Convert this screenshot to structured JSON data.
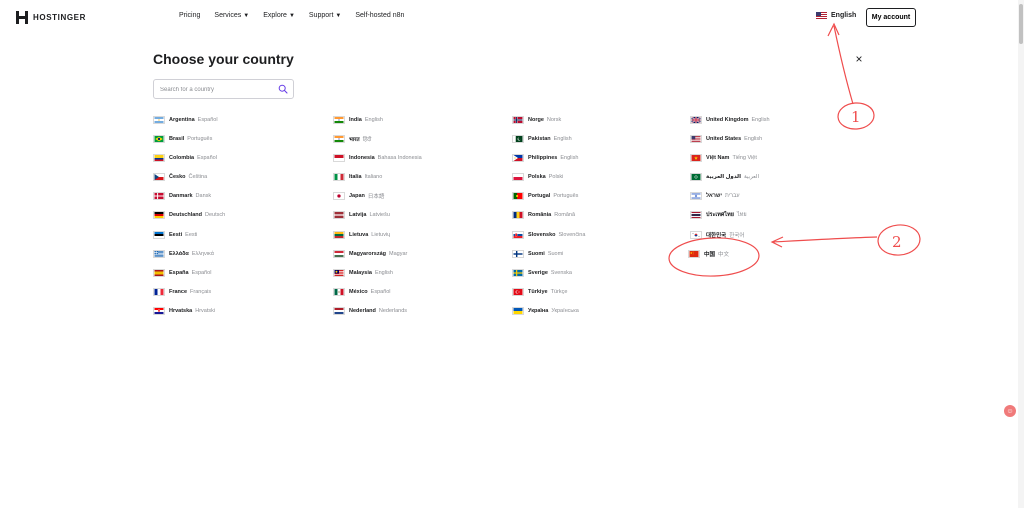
{
  "header": {
    "brand": "HOSTINGER",
    "nav": [
      {
        "label": "Pricing",
        "dropdown": false
      },
      {
        "label": "Services",
        "dropdown": true
      },
      {
        "label": "Explore",
        "dropdown": true
      },
      {
        "label": "Support",
        "dropdown": true
      },
      {
        "label": "Self-hosted n8n",
        "dropdown": false
      }
    ],
    "language": "English",
    "account": "My account"
  },
  "modal": {
    "title": "Choose your country",
    "search_placeholder": "Search for a country",
    "close_symbol": "×"
  },
  "countries": [
    {
      "name": "Argentina",
      "lang": "Español"
    },
    {
      "name": "Brasil",
      "lang": "Português"
    },
    {
      "name": "Colombia",
      "lang": "Español"
    },
    {
      "name": "Česko",
      "lang": "Čeština"
    },
    {
      "name": "Danmark",
      "lang": "Dansk"
    },
    {
      "name": "Deutschland",
      "lang": "Deutsch"
    },
    {
      "name": "Eesti",
      "lang": "Eesti"
    },
    {
      "name": "Ελλάδα",
      "lang": "Ελληνικά"
    },
    {
      "name": "España",
      "lang": "Español"
    },
    {
      "name": "France",
      "lang": "Français"
    },
    {
      "name": "Hrvatska",
      "lang": "Hrvatski"
    },
    {
      "name": "India",
      "lang": "English"
    },
    {
      "name": "भारत",
      "lang": "हिंदी"
    },
    {
      "name": "Indonesia",
      "lang": "Bahasa Indonesia"
    },
    {
      "name": "Italia",
      "lang": "Italiano"
    },
    {
      "name": "Japan",
      "lang": "日本語"
    },
    {
      "name": "Latvija",
      "lang": "Latviešu"
    },
    {
      "name": "Lietuva",
      "lang": "Lietuvių"
    },
    {
      "name": "Magyarország",
      "lang": "Magyar"
    },
    {
      "name": "Malaysia",
      "lang": "English"
    },
    {
      "name": "México",
      "lang": "Español"
    },
    {
      "name": "Nederland",
      "lang": "Nederlands"
    },
    {
      "name": "Norge",
      "lang": "Norsk"
    },
    {
      "name": "Pakistan",
      "lang": "English"
    },
    {
      "name": "Philippines",
      "lang": "English"
    },
    {
      "name": "Polska",
      "lang": "Polski"
    },
    {
      "name": "Portugal",
      "lang": "Português"
    },
    {
      "name": "România",
      "lang": "Română"
    },
    {
      "name": "Slovensko",
      "lang": "Slovenčina"
    },
    {
      "name": "Suomi",
      "lang": "Suomi"
    },
    {
      "name": "Sverige",
      "lang": "Svenska"
    },
    {
      "name": "Türkiye",
      "lang": "Türkçe"
    },
    {
      "name": "Україна",
      "lang": "Українська"
    },
    {
      "name": "United Kingdom",
      "lang": "English"
    },
    {
      "name": "United States",
      "lang": "English"
    },
    {
      "name": "Việt Nam",
      "lang": "Tiếng Việt"
    },
    {
      "name": "الدول العربية",
      "lang": "العربية"
    },
    {
      "name": "ישראל",
      "lang": "עברית"
    },
    {
      "name": "ประเทศไทย",
      "lang": "ไทย"
    },
    {
      "name": "대한민국",
      "lang": "한국어"
    },
    {
      "name": "中国",
      "lang": "中文"
    }
  ],
  "annotations": {
    "mark_1": "1",
    "mark_2": "2"
  },
  "colors": {
    "text": "#1d1e20",
    "muted": "#8a8c91",
    "accent": "#673de6",
    "annotation": "#ef4d4d"
  }
}
